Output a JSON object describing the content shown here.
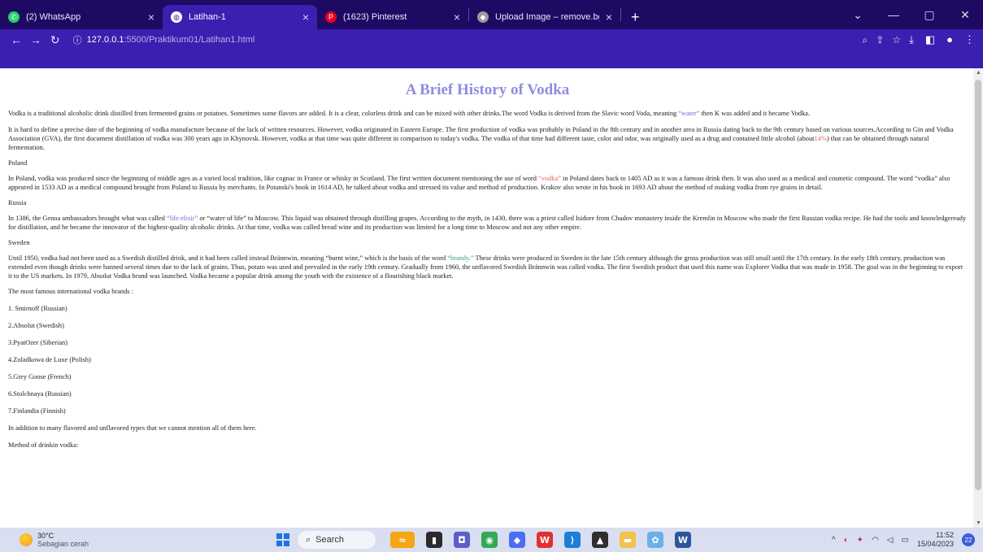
{
  "browser": {
    "tabs": [
      {
        "title": "(2) WhatsApp",
        "icon": "whatsapp-icon",
        "color": "#25d366",
        "active": false
      },
      {
        "title": "Latihan-1",
        "icon": "globe-icon",
        "color": "#ffffff",
        "active": true
      },
      {
        "title": "(1623) Pinterest",
        "icon": "pinterest-icon",
        "color": "#e60023",
        "active": false
      },
      {
        "title": "Upload Image – remove.bg",
        "icon": "removebg-icon",
        "color": "#bbbbbb",
        "active": false
      }
    ],
    "url_host": "127.0.0.1",
    "url_path": ":5500/Praktikum01/Latihan1.html"
  },
  "page": {
    "title": "A Brief History of Vodka",
    "intro_p1_a": "Vodka is a traditional alcoholic drink distilled from fermented grains or potatoes. Sometimes some flavors are added. It is a clear, colorless drink and can be mixed with other drinks.The word Vodka is derived from the Slavic word Voda, meaning ",
    "intro_p1_hl": "“water”",
    "intro_p1_b": " then K was added and it became Vodka.",
    "intro_p2_a": "It is hard to define a precise date of the beginning of vodka manufacture because of the lack of written resources. However, vodka originated in Eastern Europe. The first production of vodka was probably in Poland in the 8th century and in another area in Russia dating back to the 9th century based on various sources.According to Gin and Vodka Association (GVA), the first document distillation of vodka was 300 years ago in Khynovsk. However, vodka at that time was quite different in comparison to today's vodka. The vodka of that time had different taste, color and odor, was originally used as a drug and contained little alcohol (about",
    "intro_p2_hl": "14%",
    "intro_p2_b": ") that can be obtained through natural fermentation.",
    "poland_heading": "Poland",
    "poland_a": "In Poland, vodka was produced since the beginning of middle ages as a varied local tradition, like cognac in France or whisky in Scotland. The first written document mentioning the use of word ",
    "poland_hl": "“vodka”",
    "poland_b": " in Poland dates back to 1405 AD as it was a famous drink then. It was also used as a medical and cosmetic compound. The word “vodka” also appeared in 1533 AD as a medical compound brought from Poland to Russia by merchants. In Potanski's book in 1614 AD, he talked about vodka and stressed its value and method of production. Krakov also wrote in his book in 1693 AD about the method of making vodka from rye grains in detail.",
    "russia_heading": "Russia",
    "russia_a": "In 1386, the Genoa ambassadors brought what was called ",
    "russia_hl": "“life elixir”",
    "russia_b": " or “water of life” to Moscow. This liquid was obtained through distilling grapes. According to the myth, in 1430, there was a priest called Isidore from Chudov monastery inside the Kremlin in Moscow who made the first Russian vodka recipe. He had the tools and knowledgeready for distillation, and he became the innovator of the highest-quality alcoholic drinks. At that time, vodka was called bread wine and its production was limited for a long time to Moscow and not any other empire.",
    "sweden_heading": "Sweden",
    "sweden_a": "Until 1950, vodka had not been used as a Swedish distilled drink, and it had been called instead Brännwin, meaning “burnt wine,” which is the basis of the word ",
    "sweden_hl": "“brandy.”",
    "sweden_b": " These drinks were produced in Sweden in the late 15th century although the gross production was still small until the 17th century. In the early 18th century, production was extended even though drinks were banned several times due to the lack of grains. Thus, potato was used and prevailed in the early 19th century. Gradually from 1960, the unflavored Swedish Brännwin was called vodka. The first Swedish product that used this name was Explorer Vodka that was made in 1958. The goal was in the beginning to export it to the US markets. In 1979, Absolut Vodka brand was launched. Vodka became a popular drink among the youth with the existence of a flourishing black market.",
    "brands_heading": "The most famous international vodka brands :",
    "brands": [
      "1. Smirnoff (Russian)",
      "2.Absolut (Swedish)",
      "3.PyatOzer (Siberian)",
      "4.Zoladkowa de Luxe (Polish)",
      "5.Grey Goose (French)",
      "6.Stolchnaya (Russian)",
      "7.Finlandia (Finnish)"
    ],
    "closing": "In addition to many flavored and unflavored types that we cannot mention all of them here.",
    "method_heading": "Method of drinkin vodka:"
  },
  "taskbar": {
    "temperature": "30°C",
    "weather_desc": "Sebagian cerah",
    "search_placeholder": "Search",
    "time": "11:52",
    "date": "15/04/2023",
    "notifications": "22"
  }
}
